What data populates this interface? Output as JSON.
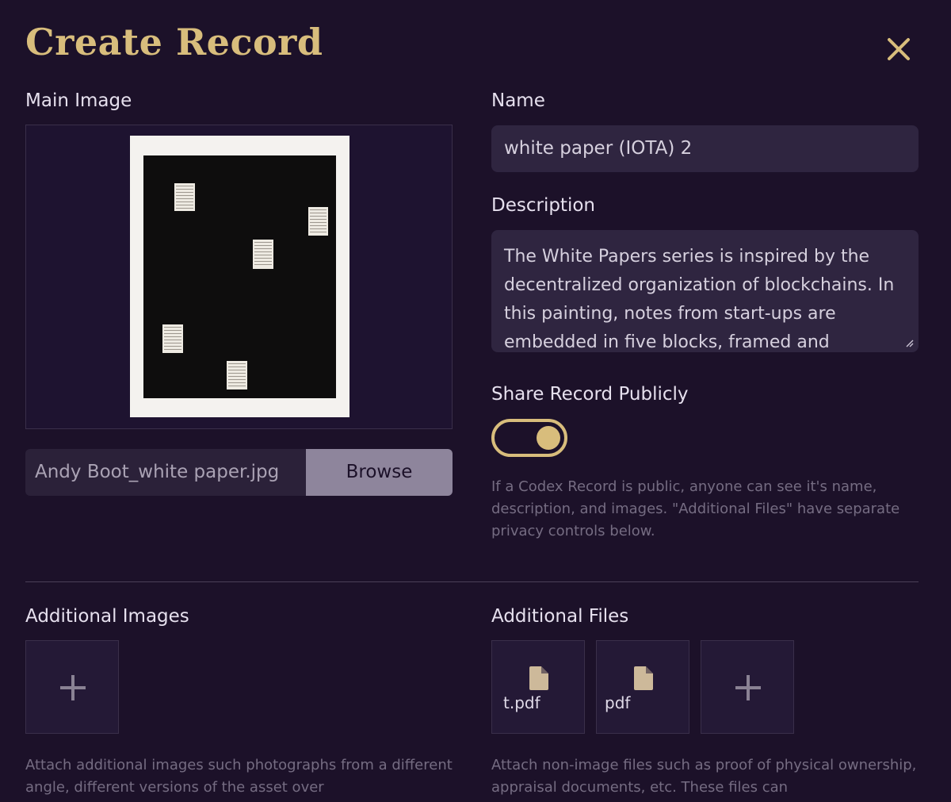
{
  "dialog": {
    "title": "Create Record"
  },
  "main_image": {
    "label": "Main Image",
    "file_name": "Andy Boot_white paper.jpg",
    "browse_label": "Browse"
  },
  "name": {
    "label": "Name",
    "value": "white paper (IOTA) 2"
  },
  "description": {
    "label": "Description",
    "value": "The White Papers series is inspired by the decentralized organization of blockchains. In this painting, notes from start-ups are embedded in five blocks, framed and"
  },
  "share": {
    "label": "Share Record Publicly",
    "enabled": true,
    "help": "If a Codex Record is public, anyone can see it's name, description, and images. \"Additional Files\" have separate privacy controls below."
  },
  "additional_images": {
    "label": "Additional Images",
    "help": "Attach additional images such photographs from a different angle, different versions of the asset over"
  },
  "additional_files": {
    "label": "Additional Files",
    "files": [
      {
        "label": "t.pdf"
      },
      {
        "label": "pdf"
      }
    ],
    "help": "Attach non-image files such as proof of physical ownership, appraisal documents, etc. These files can"
  },
  "colors": {
    "background": "#1c1129",
    "accent": "#d8bd7c",
    "input_bg": "#2f2540",
    "button_bg": "#8e859c"
  }
}
